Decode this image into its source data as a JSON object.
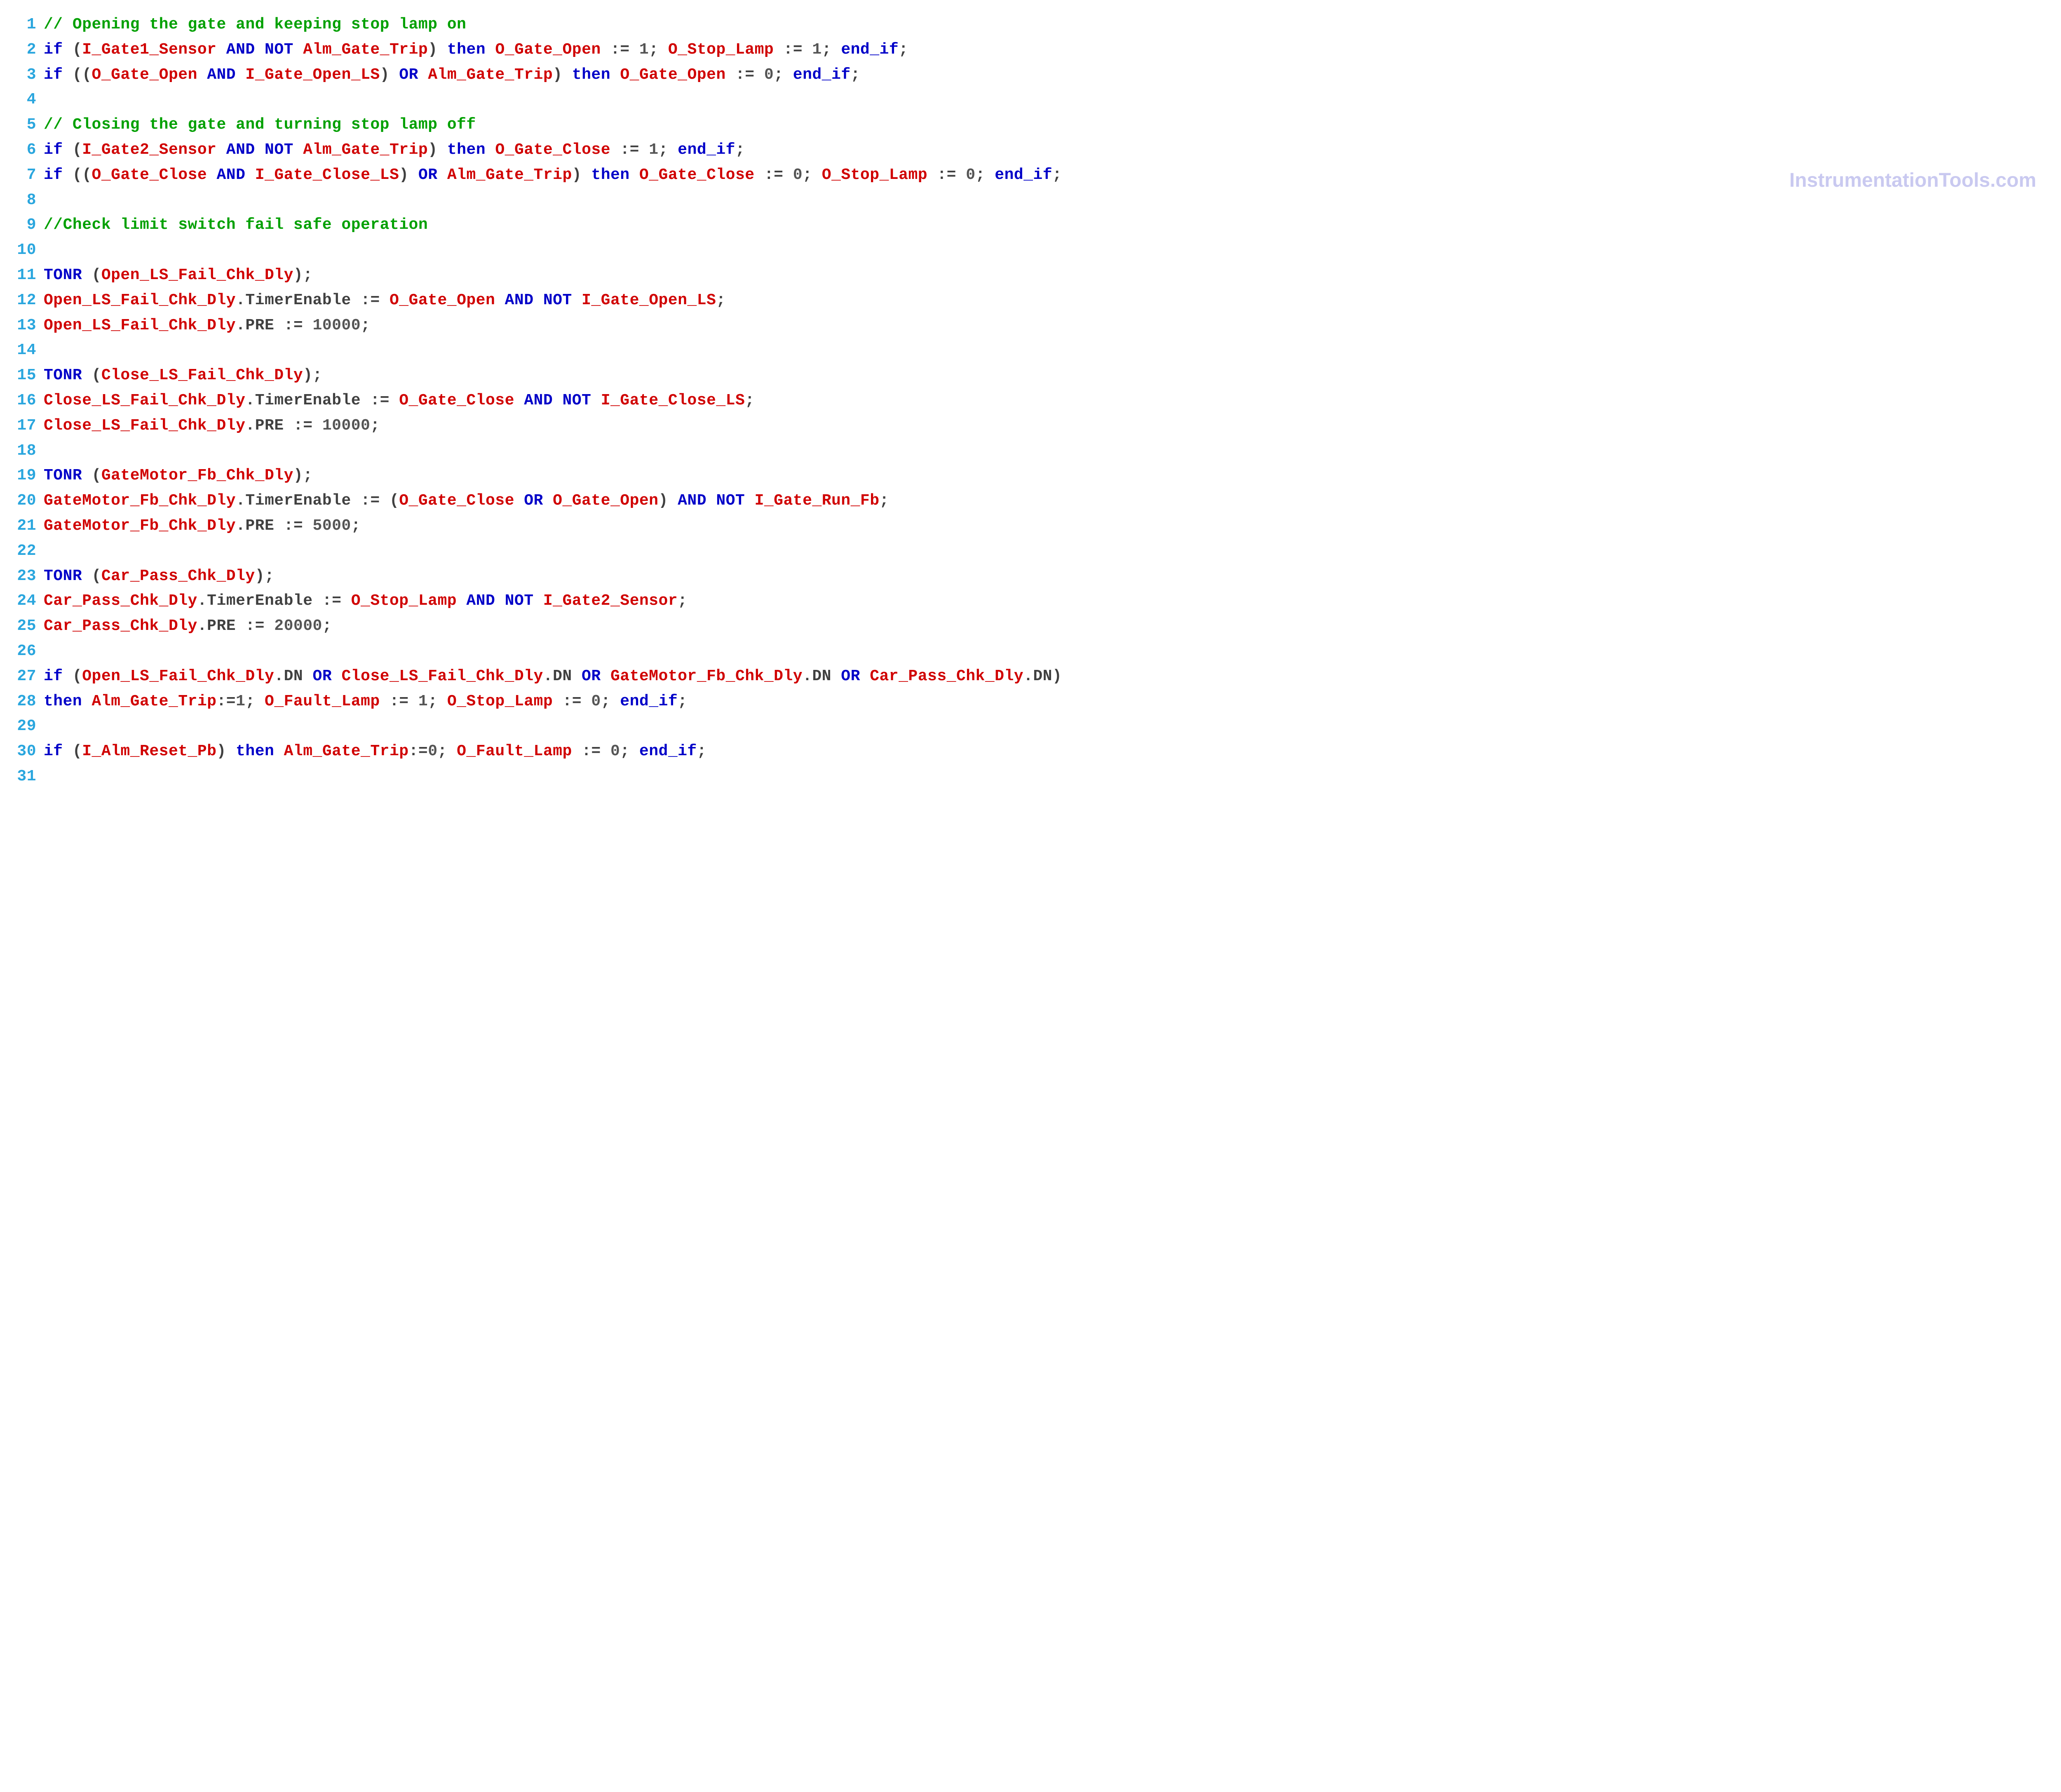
{
  "watermark": "InstrumentationTools.com",
  "lines": [
    {
      "n": 1,
      "t": [
        [
          "cm",
          "// Opening the gate and keeping stop lamp on"
        ]
      ]
    },
    {
      "n": 2,
      "t": [
        [
          "kw",
          "if"
        ],
        [
          "pn",
          " ("
        ],
        [
          "id",
          "I_Gate1_Sensor"
        ],
        [
          "pn",
          " "
        ],
        [
          "kw",
          "AND"
        ],
        [
          "pn",
          " "
        ],
        [
          "kw",
          "NOT"
        ],
        [
          "pn",
          " "
        ],
        [
          "id",
          "Alm_Gate_Trip"
        ],
        [
          "pn",
          ") "
        ],
        [
          "kw",
          "then"
        ],
        [
          "pn",
          " "
        ],
        [
          "id",
          "O_Gate_Open"
        ],
        [
          "pn",
          " := "
        ],
        [
          "num",
          "1"
        ],
        [
          "pn",
          "; "
        ],
        [
          "id",
          "O_Stop_Lamp"
        ],
        [
          "pn",
          " := "
        ],
        [
          "num",
          "1"
        ],
        [
          "pn",
          "; "
        ],
        [
          "kw",
          "end_if"
        ],
        [
          "pn",
          ";"
        ]
      ]
    },
    {
      "n": 3,
      "t": [
        [
          "kw",
          "if"
        ],
        [
          "pn",
          " (("
        ],
        [
          "id",
          "O_Gate_Open"
        ],
        [
          "pn",
          " "
        ],
        [
          "kw",
          "AND"
        ],
        [
          "pn",
          " "
        ],
        [
          "id",
          "I_Gate_Open_LS"
        ],
        [
          "pn",
          ") "
        ],
        [
          "kw",
          "OR"
        ],
        [
          "pn",
          " "
        ],
        [
          "id",
          "Alm_Gate_Trip"
        ],
        [
          "pn",
          ") "
        ],
        [
          "kw",
          "then"
        ],
        [
          "pn",
          " "
        ],
        [
          "id",
          "O_Gate_Open"
        ],
        [
          "pn",
          " := "
        ],
        [
          "num",
          "0"
        ],
        [
          "pn",
          "; "
        ],
        [
          "kw",
          "end_if"
        ],
        [
          "pn",
          ";"
        ]
      ]
    },
    {
      "n": 4,
      "t": []
    },
    {
      "n": 5,
      "t": [
        [
          "cm",
          "// Closing the gate and turning stop lamp off"
        ]
      ]
    },
    {
      "n": 6,
      "t": [
        [
          "kw",
          "if"
        ],
        [
          "pn",
          " ("
        ],
        [
          "id",
          "I_Gate2_Sensor"
        ],
        [
          "pn",
          " "
        ],
        [
          "kw",
          "AND"
        ],
        [
          "pn",
          " "
        ],
        [
          "kw",
          "NOT"
        ],
        [
          "pn",
          " "
        ],
        [
          "id",
          "Alm_Gate_Trip"
        ],
        [
          "pn",
          ") "
        ],
        [
          "kw",
          "then"
        ],
        [
          "pn",
          " "
        ],
        [
          "id",
          "O_Gate_Close"
        ],
        [
          "pn",
          " := "
        ],
        [
          "num",
          "1"
        ],
        [
          "pn",
          "; "
        ],
        [
          "kw",
          "end_if"
        ],
        [
          "pn",
          ";"
        ]
      ]
    },
    {
      "n": 7,
      "t": [
        [
          "kw",
          "if"
        ],
        [
          "pn",
          " (("
        ],
        [
          "id",
          "O_Gate_Close"
        ],
        [
          "pn",
          " "
        ],
        [
          "kw",
          "AND"
        ],
        [
          "pn",
          " "
        ],
        [
          "id",
          "I_Gate_Close_LS"
        ],
        [
          "pn",
          ") "
        ],
        [
          "kw",
          "OR"
        ],
        [
          "pn",
          " "
        ],
        [
          "id",
          "Alm_Gate_Trip"
        ],
        [
          "pn",
          ") "
        ],
        [
          "kw",
          "then"
        ],
        [
          "pn",
          " "
        ],
        [
          "id",
          "O_Gate_Close"
        ],
        [
          "pn",
          " := "
        ],
        [
          "num",
          "0"
        ],
        [
          "pn",
          "; "
        ],
        [
          "id",
          "O_Stop_Lamp"
        ],
        [
          "pn",
          " := "
        ],
        [
          "num",
          "0"
        ],
        [
          "pn",
          "; "
        ],
        [
          "kw",
          "end_if"
        ],
        [
          "pn",
          ";"
        ]
      ]
    },
    {
      "n": 8,
      "t": []
    },
    {
      "n": 9,
      "t": [
        [
          "cm",
          "//Check limit switch fail safe operation"
        ]
      ]
    },
    {
      "n": 10,
      "t": []
    },
    {
      "n": 11,
      "t": [
        [
          "kw",
          "TONR"
        ],
        [
          "pn",
          " ("
        ],
        [
          "id",
          "Open_LS_Fail_Chk_Dly"
        ],
        [
          "pn",
          ");"
        ]
      ]
    },
    {
      "n": 12,
      "t": [
        [
          "id",
          "Open_LS_Fail_Chk_Dly"
        ],
        [
          "pn",
          ".TimerEnable := "
        ],
        [
          "id",
          "O_Gate_Open"
        ],
        [
          "pn",
          " "
        ],
        [
          "kw",
          "AND"
        ],
        [
          "pn",
          " "
        ],
        [
          "kw",
          "NOT"
        ],
        [
          "pn",
          " "
        ],
        [
          "id",
          "I_Gate_Open_LS"
        ],
        [
          "pn",
          ";"
        ]
      ]
    },
    {
      "n": 13,
      "t": [
        [
          "id",
          "Open_LS_Fail_Chk_Dly"
        ],
        [
          "pn",
          ".PRE := "
        ],
        [
          "num",
          "10000"
        ],
        [
          "pn",
          ";"
        ]
      ]
    },
    {
      "n": 14,
      "t": []
    },
    {
      "n": 15,
      "t": [
        [
          "kw",
          "TONR"
        ],
        [
          "pn",
          " ("
        ],
        [
          "id",
          "Close_LS_Fail_Chk_Dly"
        ],
        [
          "pn",
          ");"
        ]
      ]
    },
    {
      "n": 16,
      "t": [
        [
          "id",
          "Close_LS_Fail_Chk_Dly"
        ],
        [
          "pn",
          ".TimerEnable := "
        ],
        [
          "id",
          "O_Gate_Close"
        ],
        [
          "pn",
          " "
        ],
        [
          "kw",
          "AND"
        ],
        [
          "pn",
          " "
        ],
        [
          "kw",
          "NOT"
        ],
        [
          "pn",
          " "
        ],
        [
          "id",
          "I_Gate_Close_LS"
        ],
        [
          "pn",
          ";"
        ]
      ]
    },
    {
      "n": 17,
      "t": [
        [
          "id",
          "Close_LS_Fail_Chk_Dly"
        ],
        [
          "pn",
          ".PRE := "
        ],
        [
          "num",
          "10000"
        ],
        [
          "pn",
          ";"
        ]
      ]
    },
    {
      "n": 18,
      "t": []
    },
    {
      "n": 19,
      "t": [
        [
          "kw",
          "TONR"
        ],
        [
          "pn",
          " ("
        ],
        [
          "id",
          "GateMotor_Fb_Chk_Dly"
        ],
        [
          "pn",
          ");"
        ]
      ]
    },
    {
      "n": 20,
      "t": [
        [
          "id",
          "GateMotor_Fb_Chk_Dly"
        ],
        [
          "pn",
          ".TimerEnable := ("
        ],
        [
          "id",
          "O_Gate_Close"
        ],
        [
          "pn",
          " "
        ],
        [
          "kw",
          "OR"
        ],
        [
          "pn",
          " "
        ],
        [
          "id",
          "O_Gate_Open"
        ],
        [
          "pn",
          ") "
        ],
        [
          "kw",
          "AND"
        ],
        [
          "pn",
          " "
        ],
        [
          "kw",
          "NOT"
        ],
        [
          "pn",
          " "
        ],
        [
          "id",
          "I_Gate_Run_Fb"
        ],
        [
          "pn",
          ";"
        ]
      ]
    },
    {
      "n": 21,
      "t": [
        [
          "id",
          "GateMotor_Fb_Chk_Dly"
        ],
        [
          "pn",
          ".PRE := "
        ],
        [
          "num",
          "5000"
        ],
        [
          "pn",
          ";"
        ]
      ]
    },
    {
      "n": 22,
      "t": []
    },
    {
      "n": 23,
      "t": [
        [
          "kw",
          "TONR"
        ],
        [
          "pn",
          " ("
        ],
        [
          "id",
          "Car_Pass_Chk_Dly"
        ],
        [
          "pn",
          ");"
        ]
      ]
    },
    {
      "n": 24,
      "t": [
        [
          "id",
          "Car_Pass_Chk_Dly"
        ],
        [
          "pn",
          ".TimerEnable := "
        ],
        [
          "id",
          "O_Stop_Lamp"
        ],
        [
          "pn",
          " "
        ],
        [
          "kw",
          "AND"
        ],
        [
          "pn",
          " "
        ],
        [
          "kw",
          "NOT"
        ],
        [
          "pn",
          " "
        ],
        [
          "id",
          "I_Gate2_Sensor"
        ],
        [
          "pn",
          ";"
        ]
      ]
    },
    {
      "n": 25,
      "t": [
        [
          "id",
          "Car_Pass_Chk_Dly"
        ],
        [
          "pn",
          ".PRE := "
        ],
        [
          "num",
          "20000"
        ],
        [
          "pn",
          ";"
        ]
      ]
    },
    {
      "n": 26,
      "t": []
    },
    {
      "n": 27,
      "t": [
        [
          "kw",
          "if"
        ],
        [
          "pn",
          " ("
        ],
        [
          "id",
          "Open_LS_Fail_Chk_Dly"
        ],
        [
          "pn",
          ".DN "
        ],
        [
          "kw",
          "OR"
        ],
        [
          "pn",
          " "
        ],
        [
          "id",
          "Close_LS_Fail_Chk_Dly"
        ],
        [
          "pn",
          ".DN "
        ],
        [
          "kw",
          "OR"
        ],
        [
          "pn",
          " "
        ],
        [
          "id",
          "GateMotor_Fb_Chk_Dly"
        ],
        [
          "pn",
          ".DN "
        ],
        [
          "kw",
          "OR"
        ],
        [
          "pn",
          " "
        ],
        [
          "id",
          "Car_Pass_Chk_Dly"
        ],
        [
          "pn",
          ".DN)"
        ]
      ]
    },
    {
      "n": 28,
      "t": [
        [
          "kw",
          "then"
        ],
        [
          "pn",
          " "
        ],
        [
          "id",
          "Alm_Gate_Trip"
        ],
        [
          "pn",
          ":="
        ],
        [
          "num",
          "1"
        ],
        [
          "pn",
          "; "
        ],
        [
          "id",
          "O_Fault_Lamp"
        ],
        [
          "pn",
          " := "
        ],
        [
          "num",
          "1"
        ],
        [
          "pn",
          "; "
        ],
        [
          "id",
          "O_Stop_Lamp"
        ],
        [
          "pn",
          " := "
        ],
        [
          "num",
          "0"
        ],
        [
          "pn",
          "; "
        ],
        [
          "kw",
          "end_if"
        ],
        [
          "pn",
          ";"
        ]
      ]
    },
    {
      "n": 29,
      "t": []
    },
    {
      "n": 30,
      "t": [
        [
          "kw",
          "if"
        ],
        [
          "pn",
          " ("
        ],
        [
          "id",
          "I_Alm_Reset_Pb"
        ],
        [
          "pn",
          ") "
        ],
        [
          "kw",
          "then"
        ],
        [
          "pn",
          " "
        ],
        [
          "id",
          "Alm_Gate_Trip"
        ],
        [
          "pn",
          ":="
        ],
        [
          "num",
          "0"
        ],
        [
          "pn",
          "; "
        ],
        [
          "id",
          "O_Fault_Lamp"
        ],
        [
          "pn",
          " := "
        ],
        [
          "num",
          "0"
        ],
        [
          "pn",
          "; "
        ],
        [
          "kw",
          "end_if"
        ],
        [
          "pn",
          ";"
        ]
      ]
    },
    {
      "n": 31,
      "t": []
    }
  ]
}
